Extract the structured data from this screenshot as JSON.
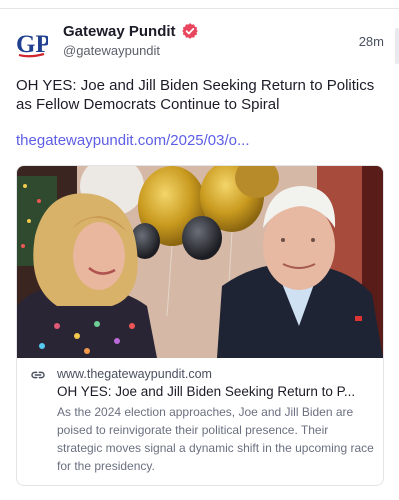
{
  "author": {
    "name": "Gateway Pundit",
    "handle": "@gatewaypundit",
    "avatar_initials": "GP",
    "time": "28m"
  },
  "post": {
    "text": "OH YES: Joe and Jill Biden Seeking Return to Politics as Fellow Democrats Continue to Spiral",
    "link": "thegatewaypundit.com/2025/03/o..."
  },
  "card": {
    "domain": "www.thegatewaypundit.com",
    "title": "OH YES: Joe and Jill Biden Seeking Return to P...",
    "description": "As the 2024 election approaches, Joe and Jill Biden are poised to reinvigorate their political presence. Their strategic moves signal a dynamic shift in the upcoming race for the presidency."
  },
  "colors": {
    "link": "#5d5ee6",
    "verified_badge": "#e8455e",
    "avatar_blue": "#1f3f8f",
    "avatar_red": "#d0262d"
  },
  "icons": [
    "verified-badge-icon",
    "link-icon"
  ]
}
